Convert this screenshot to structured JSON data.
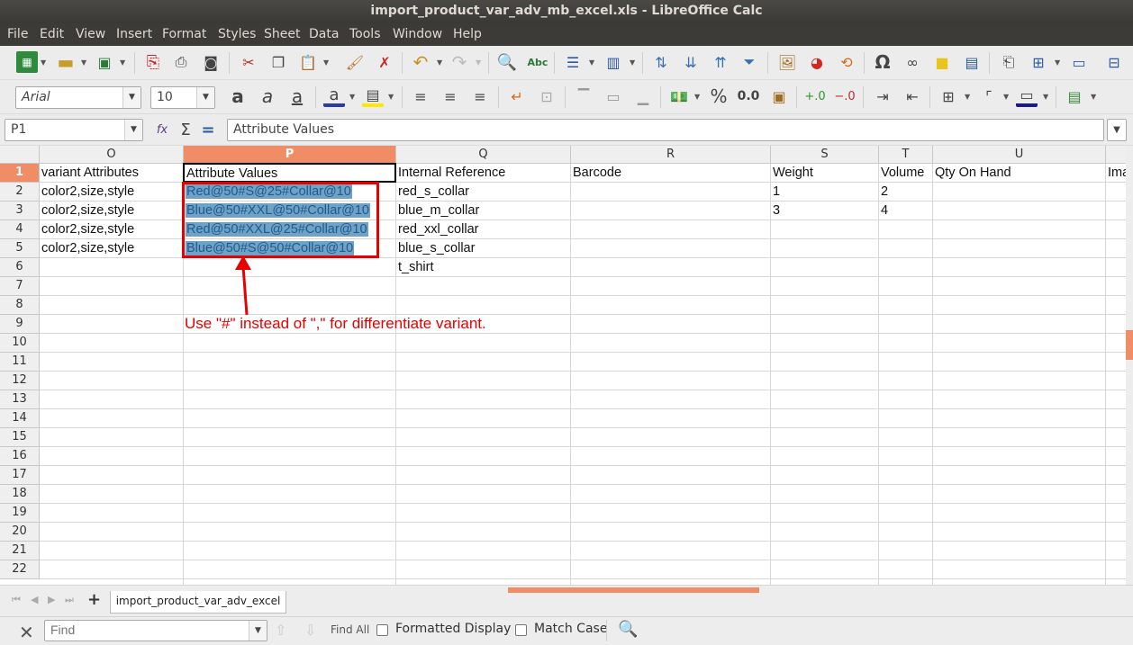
{
  "window": {
    "title": "import_product_var_adv_mb_excel.xls - LibreOffice Calc"
  },
  "menu": [
    "File",
    "Edit",
    "View",
    "Insert",
    "Format",
    "Styles",
    "Sheet",
    "Data",
    "Tools",
    "Window",
    "Help"
  ],
  "format_bar": {
    "font_name": "Arial",
    "font_size": "10",
    "percent_symbol": "%",
    "decimal_label": "0.0"
  },
  "formula_bar": {
    "cell_ref": "P1",
    "content": "Attribute Values",
    "function_icon": "fx",
    "sum_icon": "Σ",
    "equals_icon": "="
  },
  "columns": [
    {
      "label": "O",
      "selected": false
    },
    {
      "label": "P",
      "selected": true
    },
    {
      "label": "Q",
      "selected": false
    },
    {
      "label": "R",
      "selected": false
    },
    {
      "label": "S",
      "selected": false
    },
    {
      "label": "T",
      "selected": false
    },
    {
      "label": "U",
      "selected": false
    }
  ],
  "rows": [
    "1",
    "2",
    "3",
    "4",
    "5",
    "6",
    "7",
    "8",
    "9",
    "10",
    "11",
    "12",
    "13",
    "14",
    "15",
    "16",
    "17",
    "18",
    "19",
    "20",
    "21",
    "22"
  ],
  "cells": {
    "r1": {
      "O": "variant Attributes",
      "P": "Attribute Values",
      "Q": "Internal Reference",
      "R": "Barcode",
      "S": "Weight",
      "T": "Volume",
      "U": "Qty On Hand",
      "V": "Ima"
    },
    "r2": {
      "O": "color2,size,style",
      "P": "Red@50#S@25#Collar@10",
      "Q": "red_s_collar",
      "S": "1",
      "T": "2"
    },
    "r3": {
      "O": "color2,size,style",
      "P": "Blue@50#XXL@50#Collar@10",
      "Q": "blue_m_collar",
      "S": "3",
      "T": "4"
    },
    "r4": {
      "O": "color2,size,style",
      "P": "Red@50#XXL@25#Collar@10",
      "Q": "red_xxl_collar"
    },
    "r5": {
      "O": "color2,size,style",
      "P": "Blue@50#S@50#Collar@10",
      "Q": "blue_s_collar"
    },
    "r6": {
      "Q": "t_shirt"
    }
  },
  "annotation": {
    "text": "Use \"#\" instead of \",\" for differentiate variant.",
    "color": "#e60000"
  },
  "sheet_tab": "import_product_var_adv_excel",
  "find_bar": {
    "placeholder": "Find",
    "find_all": "Find All",
    "formatted_display": "Formatted Display",
    "match_case": "Match Case"
  },
  "colors": {
    "accent": "#f08d66",
    "highlight": "#6fa2c4",
    "title_bg": "#3c3b37"
  }
}
